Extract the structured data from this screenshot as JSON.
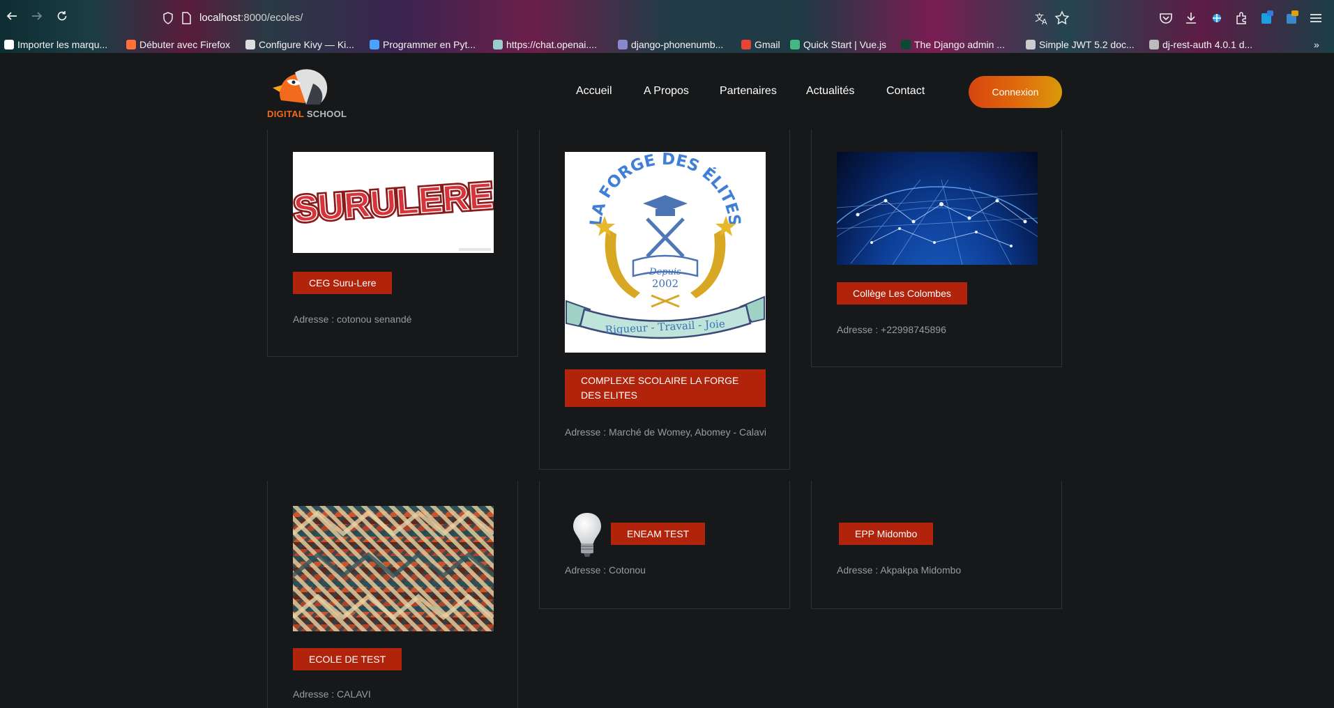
{
  "browser": {
    "url_host": "localhost",
    "url_rest": ":8000/ecoles/",
    "bookmarks": [
      {
        "label": "Importer les marqu...",
        "color": "#ffffff"
      },
      {
        "label": "Débuter avec Firefox",
        "color": "#ff7139"
      },
      {
        "label": "Configure Kivy — Ki...",
        "color": "#dddddd"
      },
      {
        "label": "Programmer en Pyt...",
        "color": "#4aa3ff"
      },
      {
        "label": "https://chat.openai....",
        "color": "#9cc"
      },
      {
        "label": "django-phonenumb...",
        "color": "#8888cc"
      },
      {
        "label": "Gmail",
        "color": "#ea4335"
      },
      {
        "label": "Quick Start | Vue.js",
        "color": "#42b883"
      },
      {
        "label": "The Django admin ...",
        "color": "#0c4b33"
      },
      {
        "label": "Simple JWT 5.2 doc...",
        "color": "#cccccc"
      },
      {
        "label": "dj-rest-auth 4.0.1 d...",
        "color": "#bbbbbb"
      }
    ]
  },
  "site": {
    "logo": {
      "word1": "DIGITAL",
      "word2": "SCHOOL"
    },
    "nav": [
      "Accueil",
      "A Propos",
      "Partenaires",
      "Actualités",
      "Contact"
    ],
    "login_label": "Connexion",
    "schools": [
      {
        "name": "CEG Suru-Lere",
        "address": "Adresse : cotonou senandé",
        "image": "surulere-logo"
      },
      {
        "name": "COMPLEXE SCOLAIRE LA FORGE DES ELITES",
        "address": "Adresse : Marché de Womey, Abomey - Calavi",
        "image": "forge-des-elites-logo",
        "logo_text": {
          "arc": "LA FORGE DES ÉLITES",
          "since": "Depuis",
          "year": "2002",
          "motto": "Rigueur - Travail - Joie"
        }
      },
      {
        "name": "Collège Les Colombes",
        "address": "Adresse : +22998745896",
        "image": "network-globe"
      },
      {
        "name": "ECOLE DE TEST",
        "address": "Adresse : CALAVI",
        "image": "knit-pattern"
      },
      {
        "name": "ENEAM TEST",
        "address": "Adresse : Cotonou",
        "image": "light-bulb"
      },
      {
        "name": "EPP Midombo",
        "address": "Adresse : Akpakpa Midombo",
        "image": "none"
      }
    ],
    "surulere_image_text": "SURULERE"
  },
  "colors": {
    "badge": "#b1230b",
    "accent_orange": "#f26a1b",
    "background": "#171819"
  }
}
